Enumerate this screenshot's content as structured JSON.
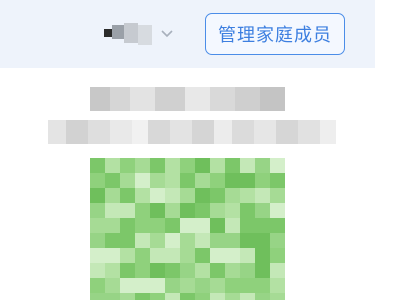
{
  "header": {
    "account_name": "",
    "manage_family_button_label": "管理家庭成员"
  },
  "icons": {
    "dropdown": "chevron-down-icon"
  },
  "colors": {
    "header_bg": "#eef3fb",
    "accent": "#3d7fe0",
    "accent_border": "#4b8de8",
    "qr_green": "#7cc769"
  }
}
